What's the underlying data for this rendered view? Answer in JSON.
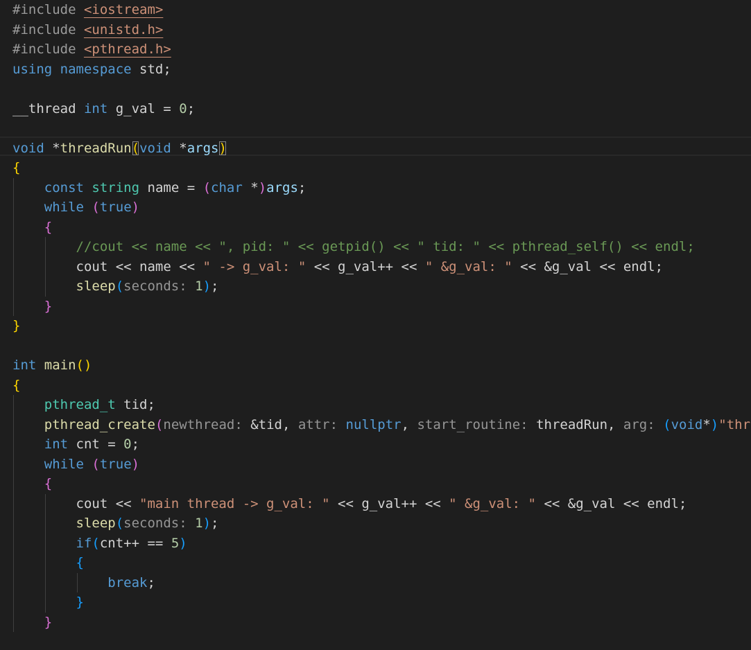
{
  "editor": {
    "language": "cpp",
    "lines": [
      [
        {
          "t": "#include ",
          "c": "#9b9b9b"
        },
        {
          "t": "<iostream>",
          "c": "#ce9178",
          "u": 1
        }
      ],
      [
        {
          "t": "#include ",
          "c": "#9b9b9b"
        },
        {
          "t": "<unistd.h>",
          "c": "#ce9178",
          "u": 1
        }
      ],
      [
        {
          "t": "#include ",
          "c": "#9b9b9b"
        },
        {
          "t": "<pthread.h>",
          "c": "#ce9178",
          "u": 1
        }
      ],
      [
        {
          "t": "using",
          "c": "#569cd6"
        },
        {
          "t": " ",
          "c": "#d4d4d4"
        },
        {
          "t": "namespace",
          "c": "#569cd6"
        },
        {
          "t": " std;",
          "c": "#d4d4d4"
        }
      ],
      [],
      [
        {
          "t": "__thread",
          "c": "#d4d4d4"
        },
        {
          "t": " ",
          "c": "#d4d4d4"
        },
        {
          "t": "int",
          "c": "#569cd6"
        },
        {
          "t": " g_val = ",
          "c": "#d4d4d4"
        },
        {
          "t": "0",
          "c": "#b5cea8"
        },
        {
          "t": ";",
          "c": "#d4d4d4"
        }
      ],
      [],
      [
        {
          "t": "void",
          "c": "#569cd6"
        },
        {
          "t": " *",
          "c": "#d4d4d4"
        },
        {
          "t": "threadRun",
          "c": "#dcdcaa"
        },
        {
          "t": "(",
          "c": "#ffd700",
          "box": 1
        },
        {
          "t": "void",
          "c": "#569cd6"
        },
        {
          "t": " *",
          "c": "#d4d4d4"
        },
        {
          "t": "args",
          "c": "#9cdcfe"
        },
        {
          "t": ")",
          "c": "#ffd700",
          "box": 1
        }
      ],
      [
        {
          "t": "{",
          "c": "#ffd700"
        }
      ],
      [
        {
          "t": "    ",
          "c": "#d4d4d4"
        },
        {
          "t": "const",
          "c": "#569cd6"
        },
        {
          "t": " ",
          "c": "#d4d4d4"
        },
        {
          "t": "string",
          "c": "#4ec9b0"
        },
        {
          "t": " name = ",
          "c": "#d4d4d4"
        },
        {
          "t": "(",
          "c": "#da70d6"
        },
        {
          "t": "char",
          "c": "#569cd6"
        },
        {
          "t": " *",
          "c": "#d4d4d4"
        },
        {
          "t": ")",
          "c": "#da70d6"
        },
        {
          "t": "args",
          "c": "#9cdcfe"
        },
        {
          "t": ";",
          "c": "#d4d4d4"
        }
      ],
      [
        {
          "t": "    ",
          "c": "#d4d4d4"
        },
        {
          "t": "while",
          "c": "#569cd6"
        },
        {
          "t": " ",
          "c": "#d4d4d4"
        },
        {
          "t": "(",
          "c": "#da70d6"
        },
        {
          "t": "true",
          "c": "#569cd6"
        },
        {
          "t": ")",
          "c": "#da70d6"
        }
      ],
      [
        {
          "t": "    ",
          "c": "#d4d4d4"
        },
        {
          "t": "{",
          "c": "#da70d6"
        }
      ],
      [
        {
          "t": "        ",
          "c": "#d4d4d4"
        },
        {
          "t": "//cout << name << \", pid: \" << getpid() << \" tid: \" << pthread_self() << endl;",
          "c": "#6a9955"
        }
      ],
      [
        {
          "t": "        cout << name << ",
          "c": "#d4d4d4"
        },
        {
          "t": "\" -> g_val: \"",
          "c": "#ce9178"
        },
        {
          "t": " << g_val++ << ",
          "c": "#d4d4d4"
        },
        {
          "t": "\" &g_val: \"",
          "c": "#ce9178"
        },
        {
          "t": " << &g_val << endl;",
          "c": "#d4d4d4"
        }
      ],
      [
        {
          "t": "        ",
          "c": "#d4d4d4"
        },
        {
          "t": "sleep",
          "c": "#dcdcaa"
        },
        {
          "t": "(",
          "c": "#179fff"
        },
        {
          "t": "seconds:",
          "c": "#969696"
        },
        {
          "t": " ",
          "c": "#d4d4d4"
        },
        {
          "t": "1",
          "c": "#b5cea8"
        },
        {
          "t": ")",
          "c": "#179fff"
        },
        {
          "t": ";",
          "c": "#d4d4d4"
        }
      ],
      [
        {
          "t": "    ",
          "c": "#d4d4d4"
        },
        {
          "t": "}",
          "c": "#da70d6"
        }
      ],
      [
        {
          "t": "}",
          "c": "#ffd700"
        }
      ],
      [],
      [
        {
          "t": "int",
          "c": "#569cd6"
        },
        {
          "t": " ",
          "c": "#d4d4d4"
        },
        {
          "t": "main",
          "c": "#dcdcaa"
        },
        {
          "t": "()",
          "c": "#ffd700"
        }
      ],
      [
        {
          "t": "{",
          "c": "#ffd700"
        }
      ],
      [
        {
          "t": "    ",
          "c": "#d4d4d4"
        },
        {
          "t": "pthread_t",
          "c": "#4ec9b0"
        },
        {
          "t": " tid;",
          "c": "#d4d4d4"
        }
      ],
      [
        {
          "t": "    ",
          "c": "#d4d4d4"
        },
        {
          "t": "pthread_create",
          "c": "#dcdcaa"
        },
        {
          "t": "(",
          "c": "#da70d6"
        },
        {
          "t": "newthread:",
          "c": "#969696"
        },
        {
          "t": " &tid, ",
          "c": "#d4d4d4"
        },
        {
          "t": "attr:",
          "c": "#969696"
        },
        {
          "t": " ",
          "c": "#d4d4d4"
        },
        {
          "t": "nullptr",
          "c": "#569cd6"
        },
        {
          "t": ", ",
          "c": "#d4d4d4"
        },
        {
          "t": "start_routine:",
          "c": "#969696"
        },
        {
          "t": " threadRun, ",
          "c": "#d4d4d4"
        },
        {
          "t": "arg:",
          "c": "#969696"
        },
        {
          "t": " ",
          "c": "#d4d4d4"
        },
        {
          "t": "(",
          "c": "#179fff"
        },
        {
          "t": "void",
          "c": "#569cd6"
        },
        {
          "t": "*",
          "c": "#d4d4d4"
        },
        {
          "t": ")",
          "c": "#179fff"
        },
        {
          "t": "\"thre",
          "c": "#ce9178"
        }
      ],
      [
        {
          "t": "    ",
          "c": "#d4d4d4"
        },
        {
          "t": "int",
          "c": "#569cd6"
        },
        {
          "t": " cnt = ",
          "c": "#d4d4d4"
        },
        {
          "t": "0",
          "c": "#b5cea8"
        },
        {
          "t": ";",
          "c": "#d4d4d4"
        }
      ],
      [
        {
          "t": "    ",
          "c": "#d4d4d4"
        },
        {
          "t": "while",
          "c": "#569cd6"
        },
        {
          "t": " ",
          "c": "#d4d4d4"
        },
        {
          "t": "(",
          "c": "#da70d6"
        },
        {
          "t": "true",
          "c": "#569cd6"
        },
        {
          "t": ")",
          "c": "#da70d6"
        }
      ],
      [
        {
          "t": "    ",
          "c": "#d4d4d4"
        },
        {
          "t": "{",
          "c": "#da70d6"
        }
      ],
      [
        {
          "t": "        cout << ",
          "c": "#d4d4d4"
        },
        {
          "t": "\"main thread -> g_val: \"",
          "c": "#ce9178"
        },
        {
          "t": " << g_val++ << ",
          "c": "#d4d4d4"
        },
        {
          "t": "\" &g_val: \"",
          "c": "#ce9178"
        },
        {
          "t": " << &g_val << endl;",
          "c": "#d4d4d4"
        }
      ],
      [
        {
          "t": "        ",
          "c": "#d4d4d4"
        },
        {
          "t": "sleep",
          "c": "#dcdcaa"
        },
        {
          "t": "(",
          "c": "#179fff"
        },
        {
          "t": "seconds:",
          "c": "#969696"
        },
        {
          "t": " ",
          "c": "#d4d4d4"
        },
        {
          "t": "1",
          "c": "#b5cea8"
        },
        {
          "t": ")",
          "c": "#179fff"
        },
        {
          "t": ";",
          "c": "#d4d4d4"
        }
      ],
      [
        {
          "t": "        ",
          "c": "#d4d4d4"
        },
        {
          "t": "if",
          "c": "#569cd6"
        },
        {
          "t": "(",
          "c": "#179fff"
        },
        {
          "t": "cnt++ == ",
          "c": "#d4d4d4"
        },
        {
          "t": "5",
          "c": "#b5cea8"
        },
        {
          "t": ")",
          "c": "#179fff"
        }
      ],
      [
        {
          "t": "        ",
          "c": "#d4d4d4"
        },
        {
          "t": "{",
          "c": "#179fff"
        }
      ],
      [
        {
          "t": "            ",
          "c": "#d4d4d4"
        },
        {
          "t": "break",
          "c": "#569cd6"
        },
        {
          "t": ";",
          "c": "#d4d4d4"
        }
      ],
      [
        {
          "t": "        ",
          "c": "#d4d4d4"
        },
        {
          "t": "}",
          "c": "#179fff"
        }
      ],
      [
        {
          "t": "    ",
          "c": "#d4d4d4"
        },
        {
          "t": "}",
          "c": "#da70d6"
        }
      ]
    ]
  }
}
